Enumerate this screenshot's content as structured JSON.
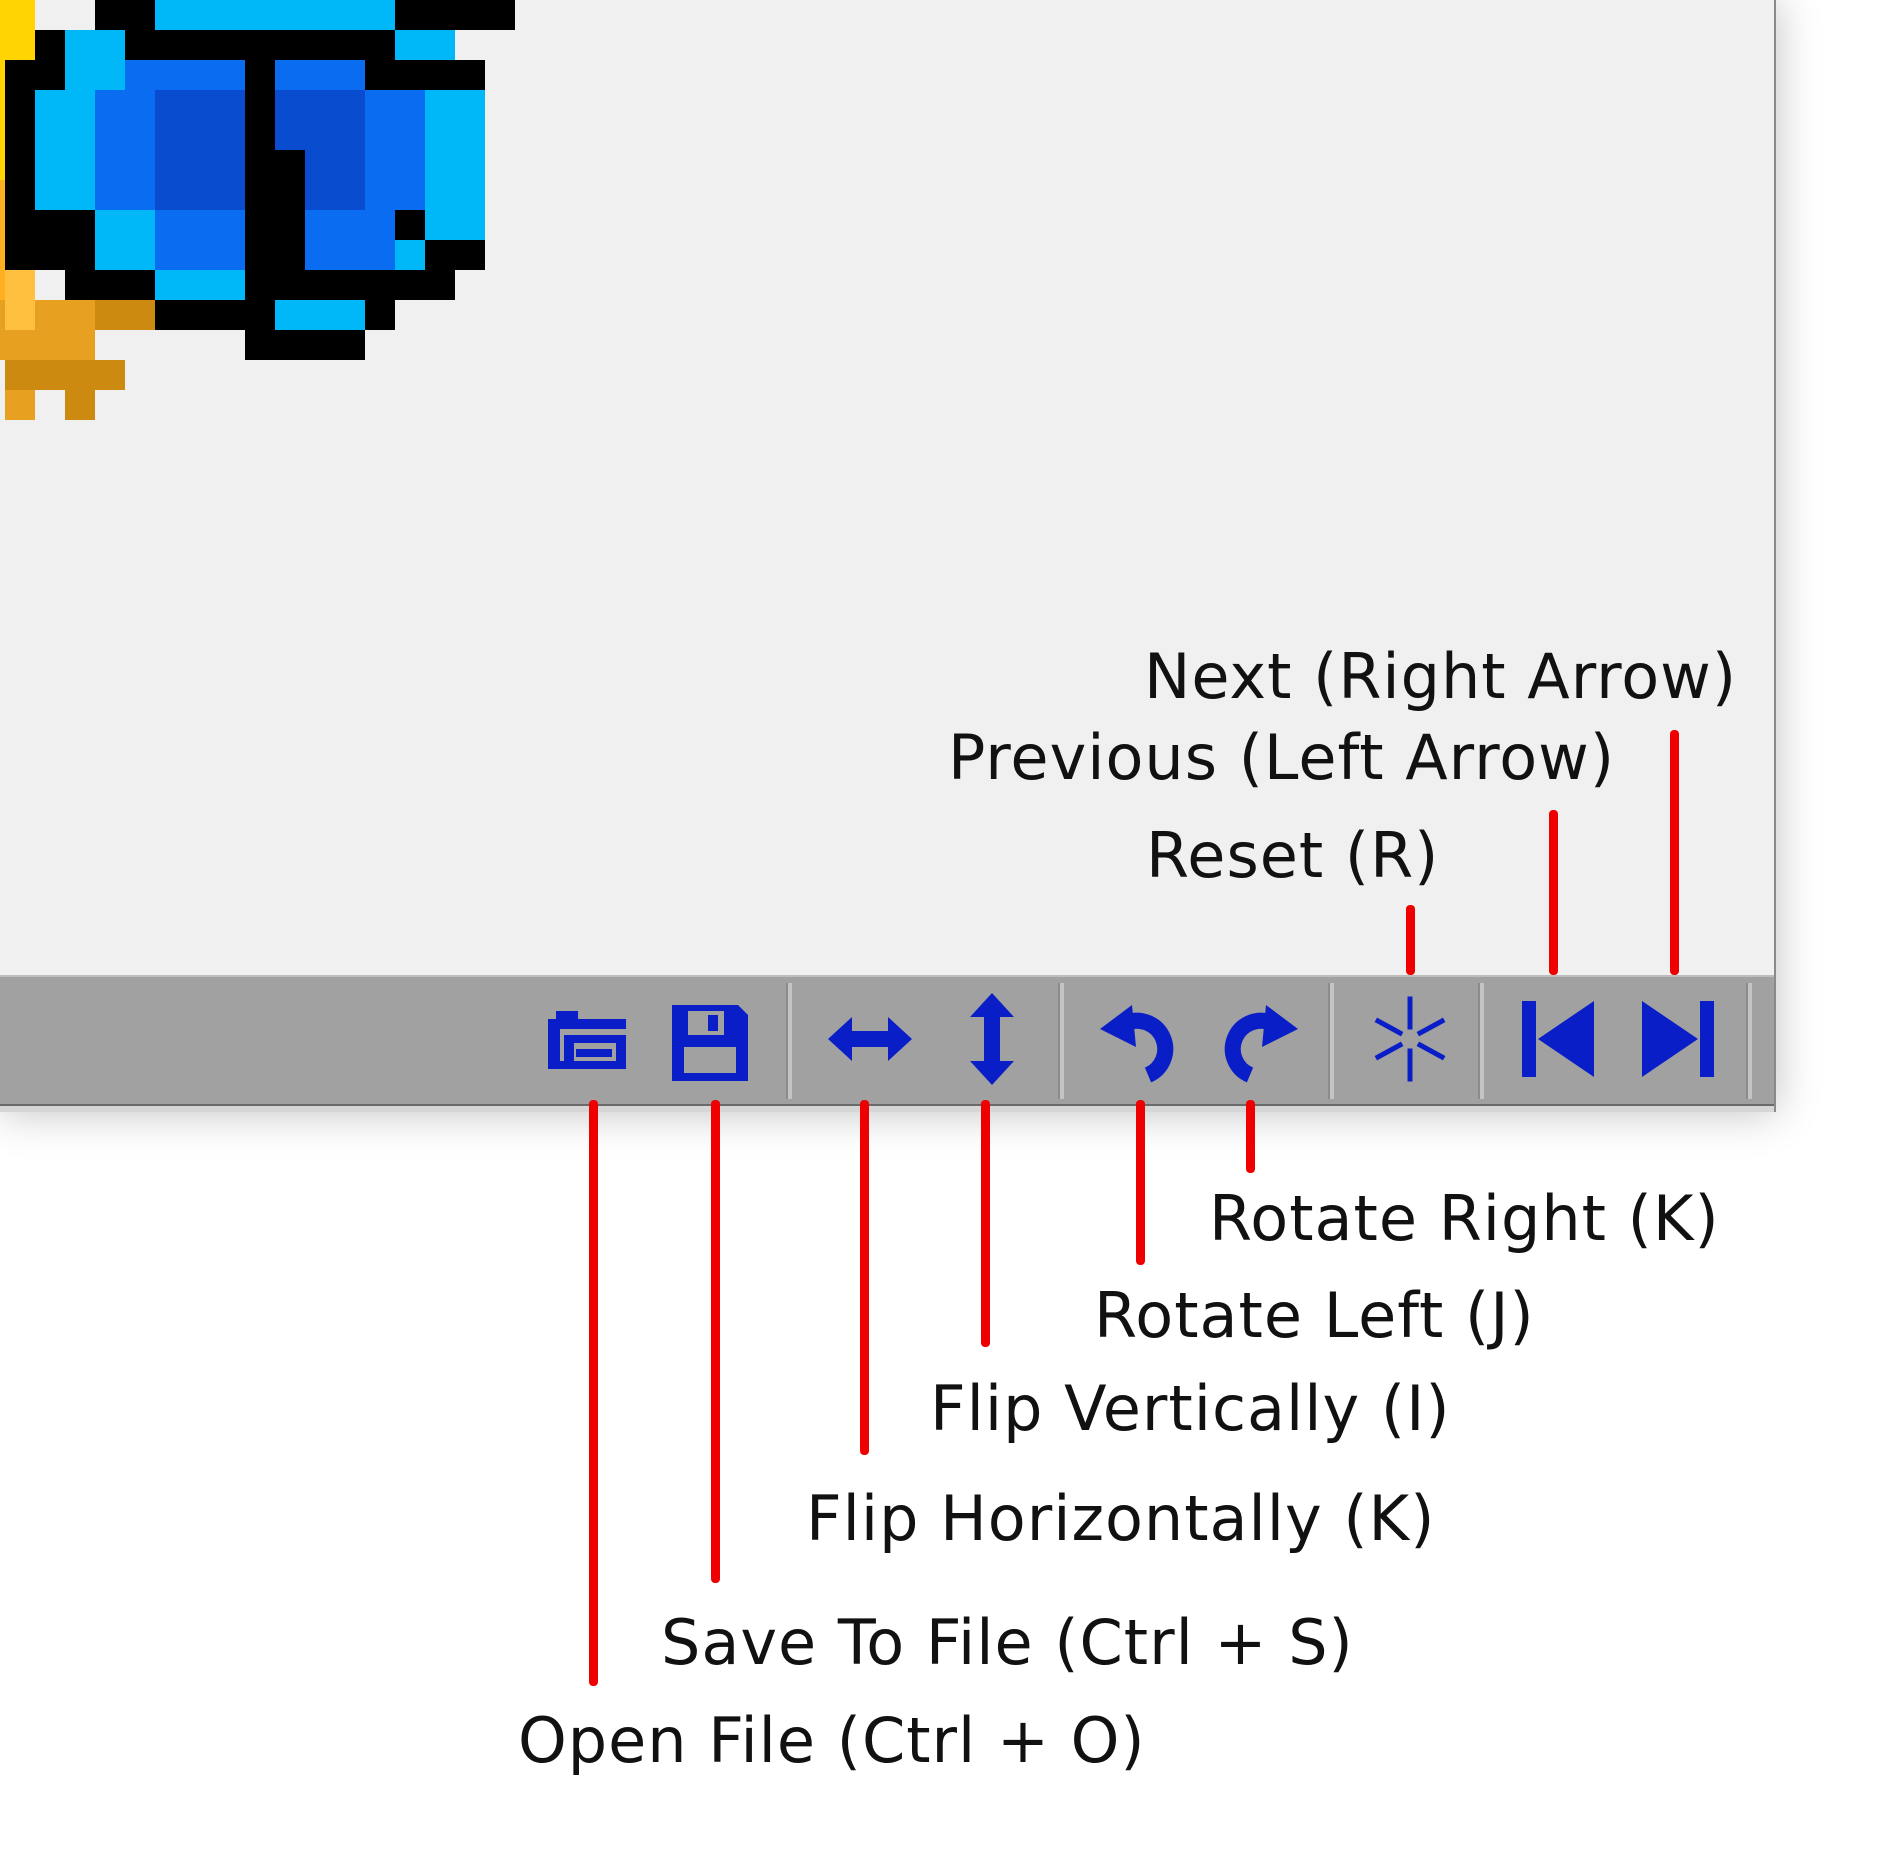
{
  "toolbar": {
    "buttons": [
      {
        "id": "open",
        "icon": "open-folder-icon"
      },
      {
        "id": "save",
        "icon": "floppy-disk-icon"
      },
      {
        "id": "flip-h",
        "icon": "horizontal-arrows-icon"
      },
      {
        "id": "flip-v",
        "icon": "vertical-arrows-icon"
      },
      {
        "id": "rotate-left",
        "icon": "rotate-left-icon"
      },
      {
        "id": "rotate-right",
        "icon": "rotate-right-icon"
      },
      {
        "id": "reset",
        "icon": "asterisk-icon"
      },
      {
        "id": "previous",
        "icon": "skip-previous-icon"
      },
      {
        "id": "next",
        "icon": "skip-next-icon"
      }
    ]
  },
  "callouts": {
    "next": "Next (Right Arrow)",
    "previous": "Previous (Left Arrow)",
    "reset": "Reset (R)",
    "rotate_right": "Rotate Right (K)",
    "rotate_left": "Rotate Left (J)",
    "flip_vertically": "Flip Vertically (I)",
    "flip_horizontally": "Flip Horizontally (K)",
    "save_to_file": "Save To File (Ctrl + S)",
    "open_file": "Open File (Ctrl + O)"
  },
  "colors": {
    "icon_blue": "#0a1ec8",
    "callout_red": "#ee0000",
    "toolbar_gray": "#a1a1a1",
    "canvas_bg": "#f0f0f0"
  }
}
